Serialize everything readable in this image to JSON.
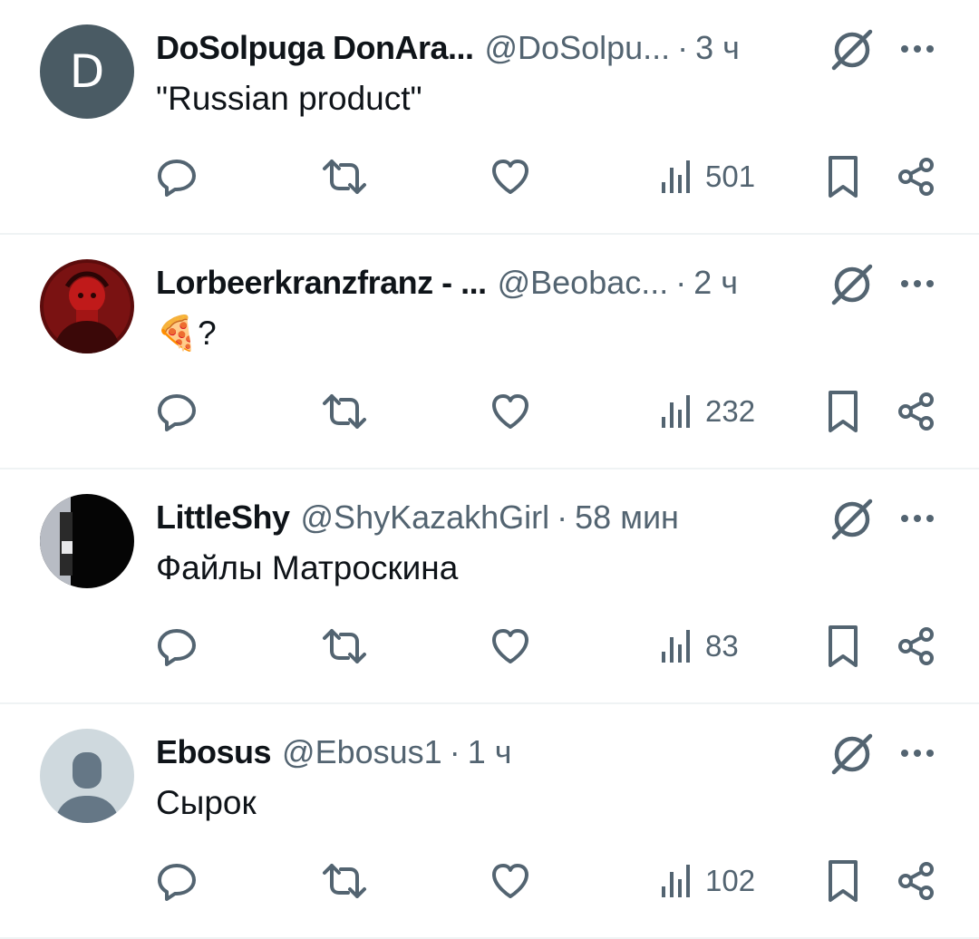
{
  "tweets": [
    {
      "avatar_letter": "D",
      "name": "DoSolpuga DonAra...",
      "handle": "@DoSolpu...",
      "separator": "·",
      "time": "3 ч",
      "text": "\"Russian product\"",
      "views": "501"
    },
    {
      "avatar_letter": "",
      "name": "Lorbeerkranzfranz - ...",
      "handle": "@Beobac...",
      "separator": "·",
      "time": "2 ч",
      "text": "🍕?",
      "views": "232"
    },
    {
      "avatar_letter": "",
      "name": "LittleShy",
      "handle": "@ShyKazakhGirl",
      "separator": "·",
      "time": "58 мин",
      "text": "Файлы Матроскина",
      "views": "83"
    },
    {
      "avatar_letter": "",
      "name": "Ebosus",
      "handle": "@Ebosus1",
      "separator": "·",
      "time": "1 ч",
      "text": "Сырок",
      "views": "102"
    }
  ],
  "colors": {
    "text": "#0f1419",
    "secondary": "#536471",
    "divider": "#eff3f4",
    "avatar_default": "#cfd9de"
  },
  "icons": [
    "reply-icon",
    "retweet-icon",
    "like-icon",
    "views-icon",
    "bookmark-icon",
    "share-icon",
    "grok-icon",
    "more-icon"
  ]
}
